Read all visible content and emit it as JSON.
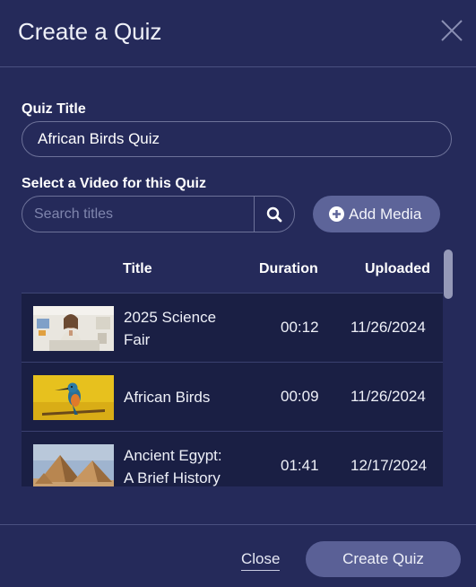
{
  "dialog": {
    "title": "Create a Quiz"
  },
  "form": {
    "quiz_title_label": "Quiz Title",
    "quiz_title_value": "African Birds Quiz",
    "video_label": "Select a Video for this Quiz",
    "search_placeholder": "Search titles",
    "add_media_label": "Add Media"
  },
  "table": {
    "columns": [
      "Title",
      "Duration",
      "Uploaded"
    ],
    "rows": [
      {
        "title_line1": "2025 Science",
        "title_line2": "Fair",
        "duration": "00:12",
        "uploaded": "11/26/2024",
        "thumbnail": "classroom-presenter-thumbnail"
      },
      {
        "title_line1": "African Birds",
        "title_line2": "",
        "duration": "00:09",
        "uploaded": "11/26/2024",
        "thumbnail": "kingfisher-bird-thumbnail"
      },
      {
        "title_line1": "Ancient Egypt:",
        "title_line2": "A Brief History",
        "duration": "01:41",
        "uploaded": "12/17/2024",
        "thumbnail": "pyramids-thumbnail"
      }
    ]
  },
  "footer": {
    "close_label": "Close",
    "create_label": "Create Quiz"
  },
  "icons": {
    "close": "close-icon",
    "search": "search-icon",
    "add": "plus-circle-icon"
  },
  "colors": {
    "background": "#252a5a",
    "row_background": "#1a1f44",
    "button": "#5a6096"
  }
}
